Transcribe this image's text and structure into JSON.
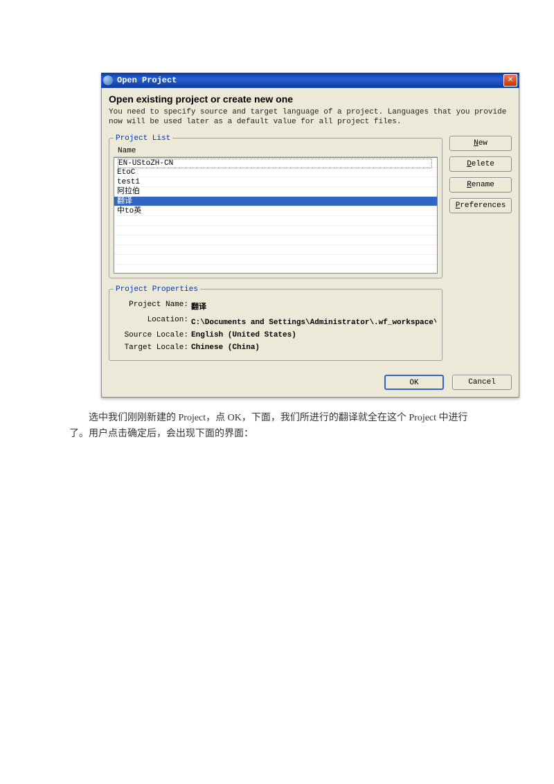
{
  "dialog": {
    "title": "Open Project",
    "heading": "Open existing project or create new one",
    "description": "You need to specify source and target language of a project. Languages that you provide now will be used later as a default value for all project files."
  },
  "project_list": {
    "legend": "Project List",
    "column_header": "Name",
    "items": [
      "EN-UStoZH-CN",
      "EtoC",
      "test1",
      "阿拉伯",
      "翻译",
      "中to英"
    ],
    "selected_index": 4
  },
  "buttons": {
    "new": "New",
    "delete": "Delete",
    "rename": "Rename",
    "preferences": "Preferences",
    "ok": "OK",
    "cancel": "Cancel"
  },
  "project_properties": {
    "legend": "Project Properties",
    "labels": {
      "project_name": "Project Name:",
      "location": "Location:",
      "source_locale": "Source Locale:",
      "target_locale": "Target Locale:"
    },
    "values": {
      "project_name": "翻译",
      "location": "C:\\Documents and Settings\\Administrator\\.wf_workspace\\翻译\\pr",
      "source_locale": "English (United States)",
      "target_locale": "Chinese (China)"
    }
  },
  "caption": "选中我们刚刚新建的 Project，点 OK，下面，我们所进行的翻译就全在这个 Project 中进行了。用户点击确定后，会出现下面的界面："
}
